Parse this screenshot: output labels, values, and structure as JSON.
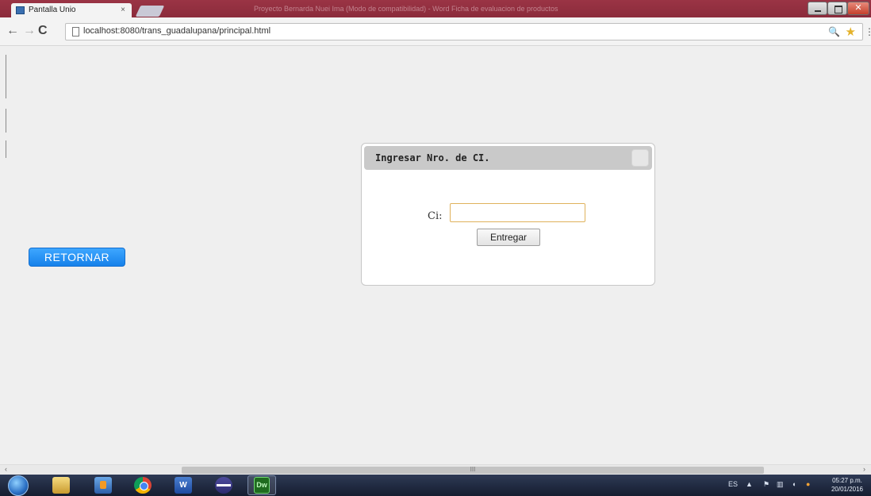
{
  "browser": {
    "tab_title": "Pantalla Unio",
    "tab_close": "×",
    "window_title_blurred": "Proyecto Bernarda Nuei Ima (Modo de compatibilidad) - Word Ficha de evaluacion de productos",
    "url": "localhost:8080/trans_guadalupana/principal.html",
    "nav": {
      "back": "←",
      "forward": "→",
      "reload": "C"
    },
    "close_glyph": "✕",
    "zoom_glyph": "🔍",
    "star_glyph": "★",
    "menu_glyph": "⋮"
  },
  "page": {
    "retornar_label": "RETORNAR",
    "dialog": {
      "title": "Ingresar Nro. de CI.",
      "ci_label": "Ci:",
      "ci_value": "",
      "submit_label": "Entregar"
    }
  },
  "scrollbar": {
    "left": "‹",
    "right": "›",
    "thumb_grip": "III"
  },
  "taskbar": {
    "apps": [
      "start",
      "explorer",
      "media-player",
      "chrome",
      "word",
      "eclipse",
      "dreamweaver"
    ],
    "word_label": "W",
    "dw_label": "Dw",
    "tray": {
      "lang": "ES",
      "arrow": "▲",
      "flag": "⚑",
      "net": "▥",
      "vol": "◖",
      "alert": "●"
    },
    "clock_time": "05:27 p.m.",
    "clock_date": "20/01/2016"
  },
  "colors": {
    "titlebar": "#8b2b3b",
    "retornar": "#1e8cf3",
    "dialog_header": "#c9c9c9",
    "input_border": "#e0b25c"
  }
}
